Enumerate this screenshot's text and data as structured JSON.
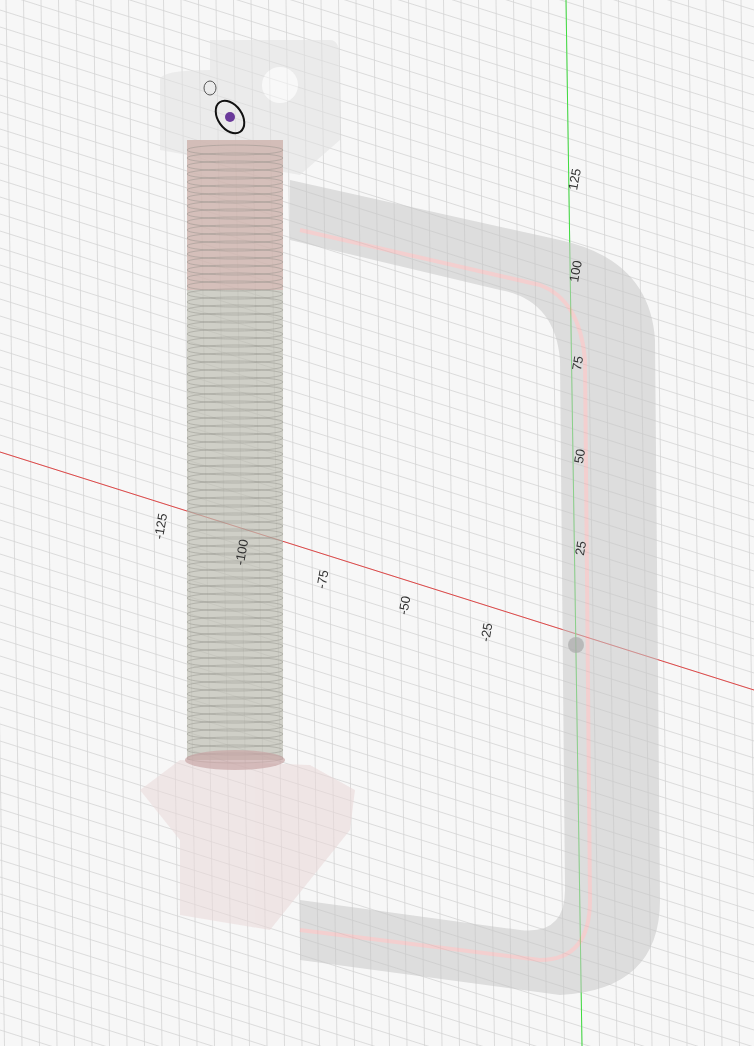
{
  "viewport": {
    "x_axis_labels": [
      "-125",
      "-100",
      "-75",
      "-50",
      "-25"
    ],
    "y_axis_labels": [
      "125",
      "100",
      "75",
      "50",
      "25"
    ]
  }
}
